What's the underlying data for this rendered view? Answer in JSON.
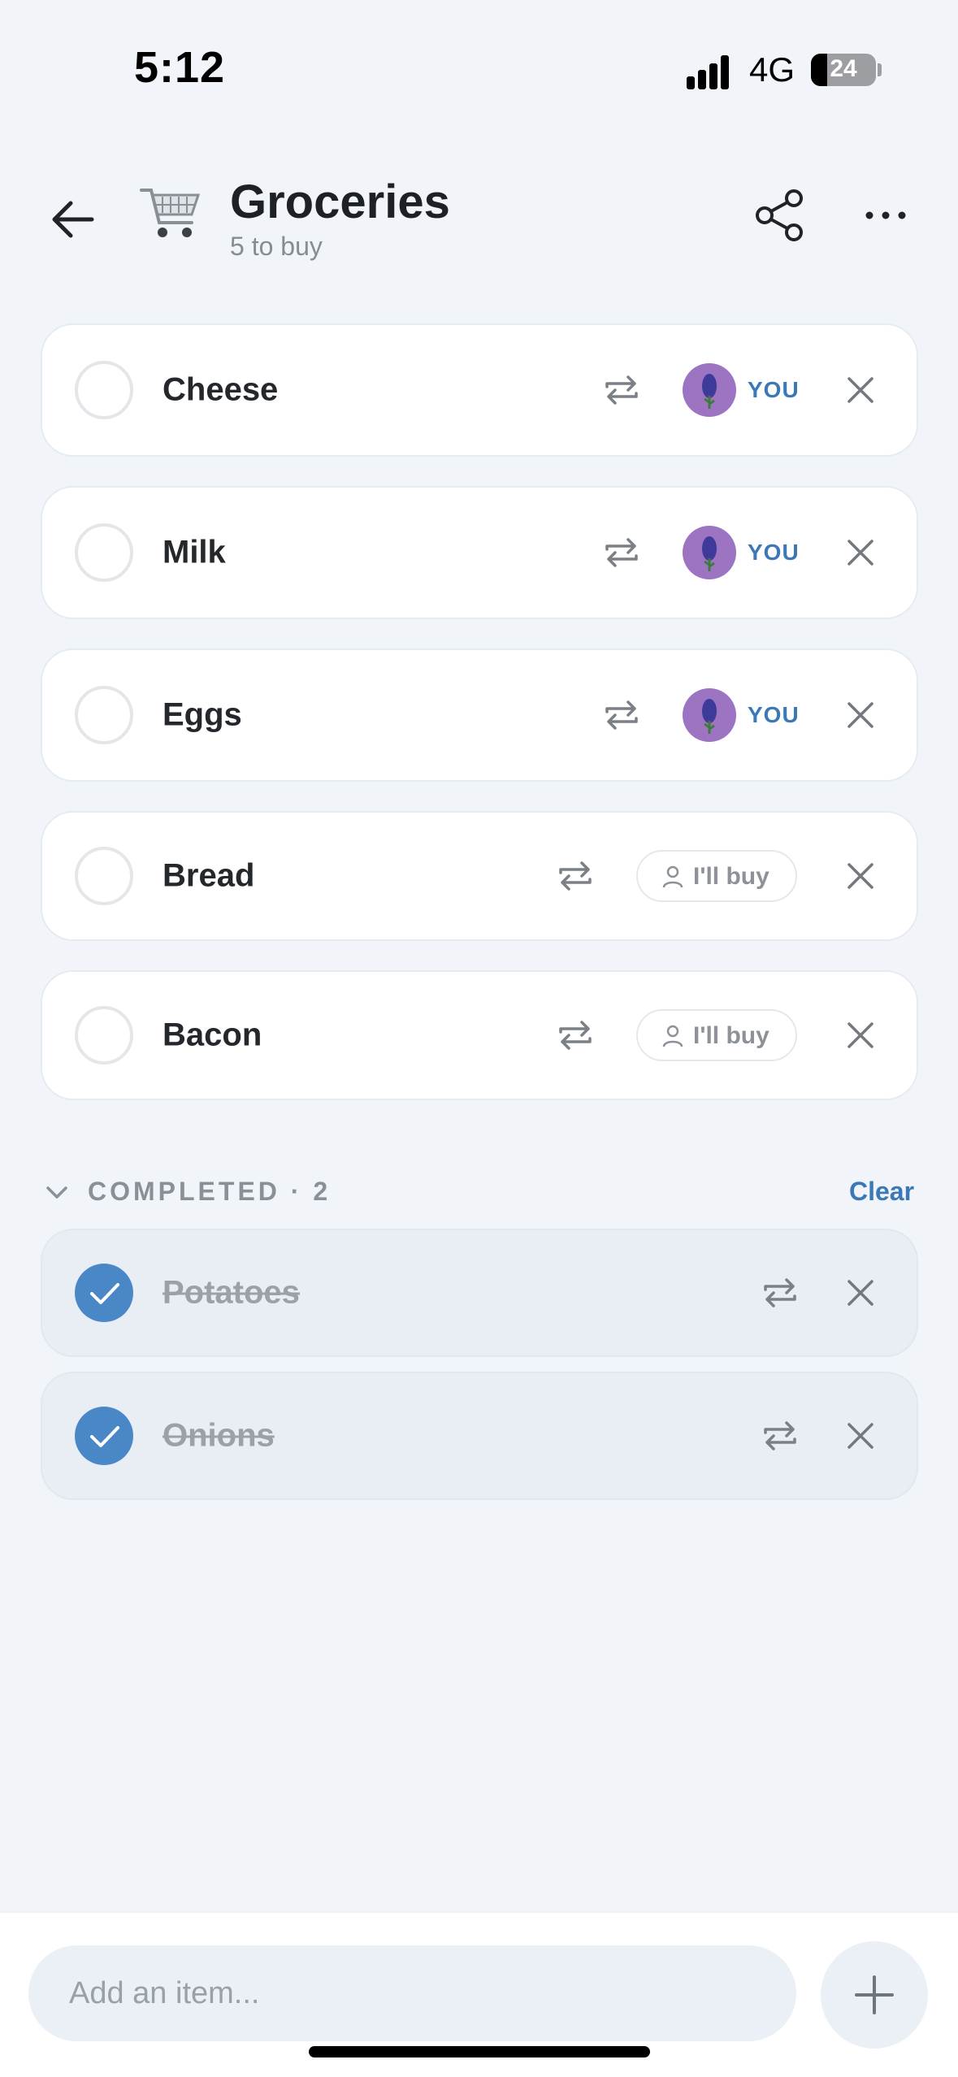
{
  "status_bar": {
    "time": "5:12",
    "network": "4G",
    "battery": "24"
  },
  "header": {
    "title": "Groceries",
    "subtitle": "5 to buy",
    "cart_icon": "shopping-cart-icon"
  },
  "items": [
    {
      "name": "Cheese",
      "assignee": "YOU"
    },
    {
      "name": "Milk",
      "assignee": "YOU"
    },
    {
      "name": "Eggs",
      "assignee": "YOU"
    },
    {
      "name": "Bread",
      "assignee_button": "I'll buy"
    },
    {
      "name": "Bacon",
      "assignee_button": "I'll buy"
    }
  ],
  "completed": {
    "label": "COMPLETED · 2",
    "clear_label": "Clear",
    "items": [
      {
        "name": "Potatoes"
      },
      {
        "name": "Onions"
      }
    ]
  },
  "add_bar": {
    "placeholder": "Add an item..."
  },
  "colors": {
    "accent": "#3b78b7",
    "checked": "#4987c6",
    "avatar": "#9d74c2",
    "background": "#f1f5fa"
  }
}
